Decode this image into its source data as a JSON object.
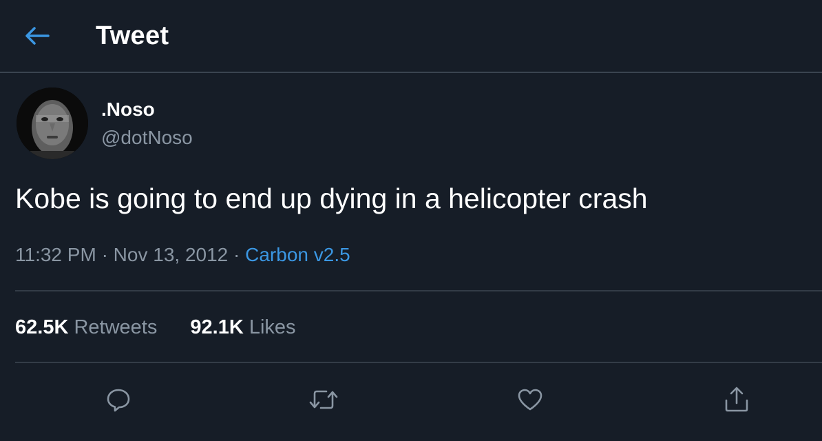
{
  "header": {
    "title": "Tweet",
    "back_icon": "arrow-left-icon"
  },
  "author": {
    "display_name": ".Noso",
    "handle": "@dotNoso"
  },
  "tweet": {
    "text": "Kobe is going to end up dying in a helicopter crash",
    "time": "11:32 PM",
    "separator": "·",
    "date": "Nov 13, 2012",
    "source": "Carbon v2.5"
  },
  "stats": {
    "retweets_count": "62.5K",
    "retweets_label": "Retweets",
    "likes_count": "92.1K",
    "likes_label": "Likes"
  },
  "actions": [
    "reply-icon",
    "retweet-icon",
    "like-icon",
    "share-icon"
  ],
  "colors": {
    "background": "#161d27",
    "accent": "#3b97e3",
    "secondary_text": "#8a96a3",
    "divider": "#333c47"
  }
}
